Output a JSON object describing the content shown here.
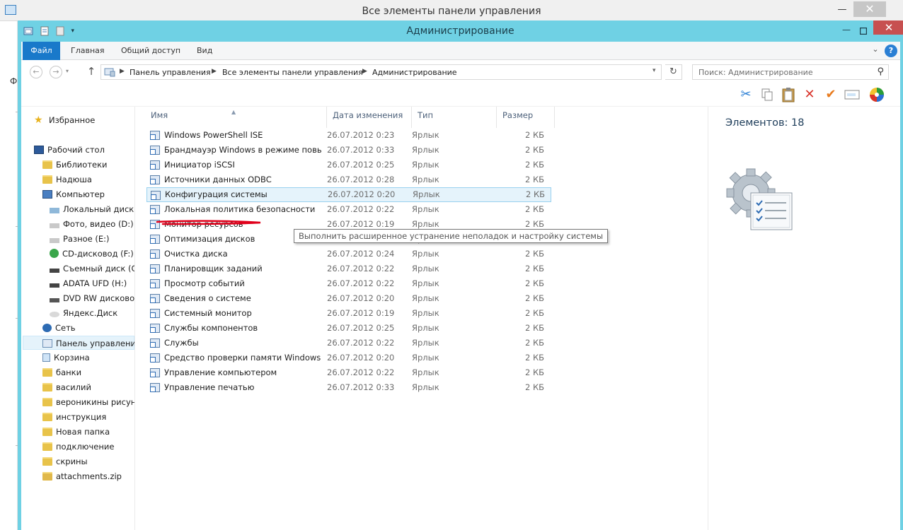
{
  "background_window": {
    "title": "Все элементы панели управления",
    "left_letter": "Ф"
  },
  "window": {
    "title": "Администрирование",
    "min": "—",
    "close": "✕"
  },
  "ribbon": {
    "tabs": [
      "Файл",
      "Главная",
      "Общий доступ",
      "Вид"
    ],
    "help": "?"
  },
  "address": {
    "crumbs": [
      "Панель управления",
      "Все элементы панели управления",
      "Администрирование"
    ],
    "search_placeholder": "Поиск: Администрирование"
  },
  "nav": {
    "favorites": "Избранное",
    "desktop": "Рабочий стол",
    "libraries": "Библиотеки",
    "user": "Надюша",
    "computer": "Компьютер",
    "drives": [
      "Локальный диск (C:)",
      "Фото, видео (D:)",
      "Разное (E:)",
      "CD-дисковод (F:)",
      "Съемный диск (G:)",
      "ADATA UFD (H:)",
      "DVD RW дисковод",
      "Яндекс.Диск"
    ],
    "network": "Сеть",
    "control_panel": "Панель управления",
    "recycle": "Корзина",
    "folders": [
      "банки",
      "василий",
      "вероникины рисунки",
      "инструкция",
      "Новая папка",
      "подключение",
      "скрины"
    ],
    "zip": "attachments.zip"
  },
  "columns": {
    "name": "Имя",
    "date": "Дата изменения",
    "type": "Тип",
    "size": "Размер"
  },
  "files": [
    {
      "name": "Windows PowerShell ISE",
      "date": "26.07.2012 0:23",
      "type": "Ярлык",
      "size": "2 КБ"
    },
    {
      "name": "Брандмауэр Windows в режиме повы...",
      "date": "26.07.2012 0:33",
      "type": "Ярлык",
      "size": "2 КБ"
    },
    {
      "name": "Инициатор iSCSI",
      "date": "26.07.2012 0:25",
      "type": "Ярлык",
      "size": "2 КБ"
    },
    {
      "name": "Источники данных ODBC",
      "date": "26.07.2012 0:28",
      "type": "Ярлык",
      "size": "2 КБ"
    },
    {
      "name": "Конфигурация системы",
      "date": "26.07.2012 0:20",
      "type": "Ярлык",
      "size": "2 КБ"
    },
    {
      "name": "Локальная политика безопасности",
      "date": "26.07.2012 0:22",
      "type": "Ярлык",
      "size": "2 КБ"
    },
    {
      "name": "Монитор ресурсов",
      "date": "26.07.2012 0:19",
      "type": "Ярлык",
      "size": "2 КБ"
    },
    {
      "name": "Оптимизация дисков",
      "date": "26.07.2012 0:20",
      "type": "Ярлык",
      "size": "2 КБ"
    },
    {
      "name": "Очистка диска",
      "date": "26.07.2012 0:24",
      "type": "Ярлык",
      "size": "2 КБ"
    },
    {
      "name": "Планировщик заданий",
      "date": "26.07.2012 0:22",
      "type": "Ярлык",
      "size": "2 КБ"
    },
    {
      "name": "Просмотр событий",
      "date": "26.07.2012 0:22",
      "type": "Ярлык",
      "size": "2 КБ"
    },
    {
      "name": "Сведения о системе",
      "date": "26.07.2012 0:20",
      "type": "Ярлык",
      "size": "2 КБ"
    },
    {
      "name": "Системный монитор",
      "date": "26.07.2012 0:19",
      "type": "Ярлык",
      "size": "2 КБ"
    },
    {
      "name": "Службы компонентов",
      "date": "26.07.2012 0:25",
      "type": "Ярлык",
      "size": "2 КБ"
    },
    {
      "name": "Службы",
      "date": "26.07.2012 0:22",
      "type": "Ярлык",
      "size": "2 КБ"
    },
    {
      "name": "Средство проверки памяти Windows",
      "date": "26.07.2012 0:20",
      "type": "Ярлык",
      "size": "2 КБ"
    },
    {
      "name": "Управление компьютером",
      "date": "26.07.2012 0:22",
      "type": "Ярлык",
      "size": "2 КБ"
    },
    {
      "name": "Управление печатью",
      "date": "26.07.2012 0:33",
      "type": "Ярлык",
      "size": "2 КБ"
    }
  ],
  "tooltip": "Выполнить расширенное устранение неполадок и настройку системы",
  "details": {
    "count": "Элементов: 18"
  },
  "colors": {
    "titlebar": "#6fd1e4",
    "file_tab": "#1979ca",
    "close": "#c75050",
    "annotation": "#e0001b"
  },
  "icons": {
    "toolbar": [
      "scissors-icon",
      "copy-icon",
      "paste-icon",
      "delete-icon",
      "check-icon",
      "rename-icon",
      "color-wheel-icon"
    ]
  }
}
